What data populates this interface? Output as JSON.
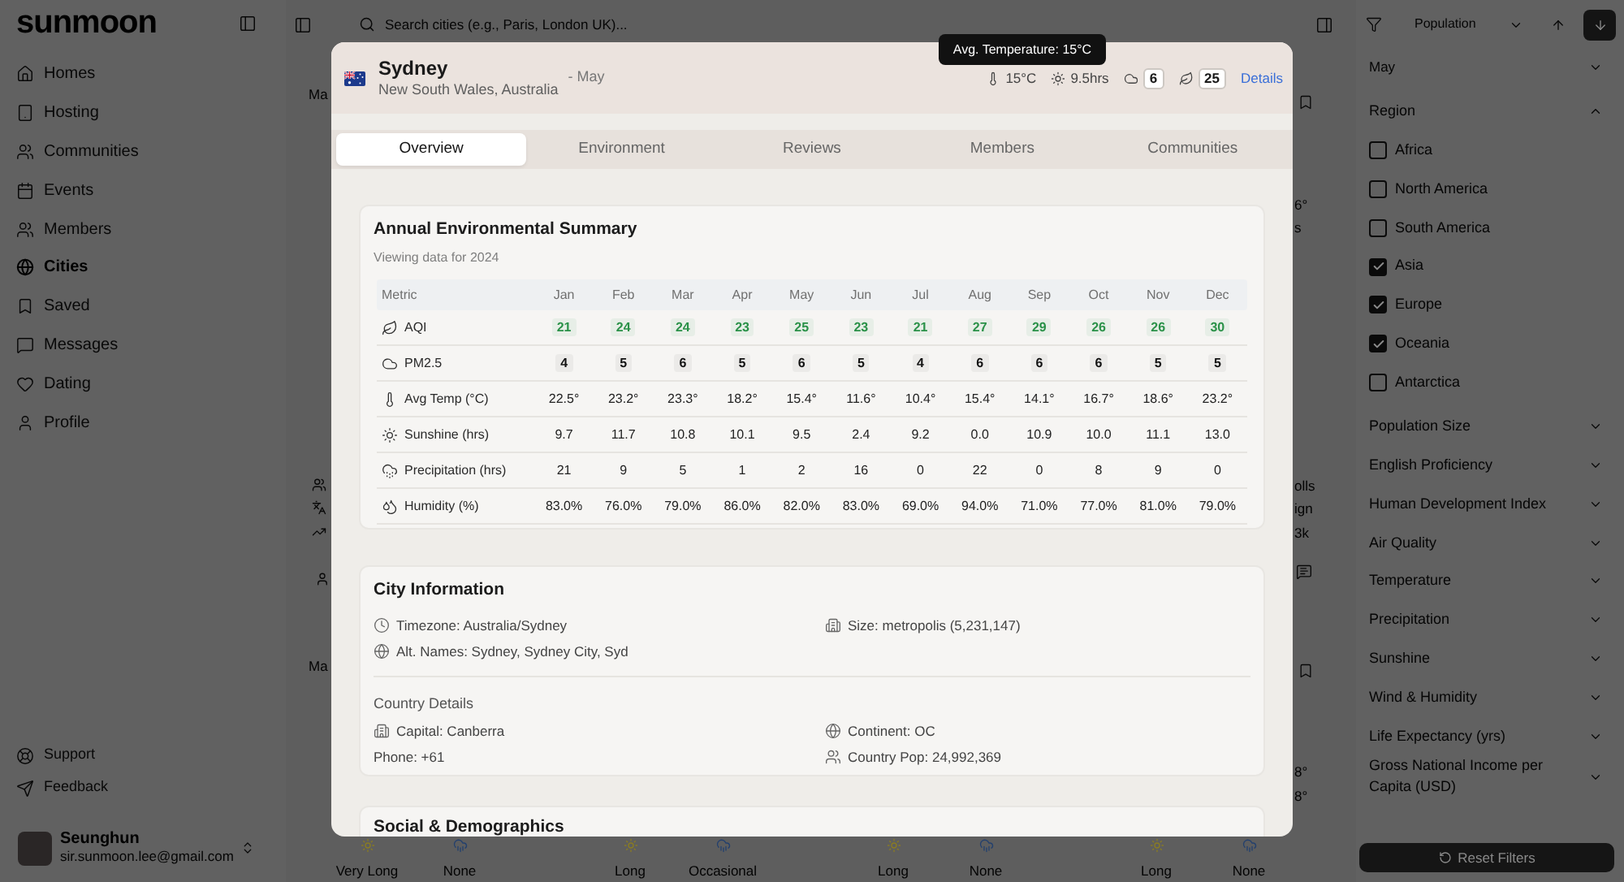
{
  "app": {
    "logo": "sunmoon"
  },
  "sidebar": {
    "items": [
      {
        "label": "Homes",
        "selected": false
      },
      {
        "label": "Hosting",
        "selected": false
      },
      {
        "label": "Communities",
        "selected": false
      },
      {
        "label": "Events",
        "selected": false
      },
      {
        "label": "Members",
        "selected": false
      },
      {
        "label": "Cities",
        "selected": true
      },
      {
        "label": "Saved",
        "selected": false
      },
      {
        "label": "Messages",
        "selected": false
      },
      {
        "label": "Dating",
        "selected": false
      },
      {
        "label": "Profile",
        "selected": false
      }
    ],
    "footer_items": [
      {
        "label": "Support"
      },
      {
        "label": "Feedback"
      }
    ],
    "user": {
      "name": "Seunghun",
      "email": "sir.sunmoon.lee@gmail.com"
    }
  },
  "topbar": {
    "search": {
      "placeholder": "Search cities (e.g., Paris, London UK)..."
    },
    "sort": {
      "value": "Population"
    },
    "sort_buttons": [
      {
        "kind": "ascending",
        "selected": false
      },
      {
        "kind": "descending",
        "selected": true
      }
    ]
  },
  "background": {
    "left_fragments": [
      "Ma",
      "Ma"
    ],
    "right_fragments": [
      "6°",
      "s",
      "olls",
      "ign",
      "3k",
      "8°",
      "8°"
    ],
    "bottom_items": [
      {
        "kind": "sunshine",
        "label": "Very Long"
      },
      {
        "kind": "rain",
        "label": "None"
      },
      {
        "kind": "sunshine",
        "label": "Long"
      },
      {
        "kind": "rain",
        "label": "Occasional"
      },
      {
        "kind": "sunshine",
        "label": "Long"
      },
      {
        "kind": "rain",
        "label": "None"
      },
      {
        "kind": "sunshine",
        "label": "Long"
      },
      {
        "kind": "rain",
        "label": "None"
      }
    ]
  },
  "filters": {
    "month": "May",
    "sections": [
      {
        "title": "Region",
        "expanded": true,
        "options": [
          {
            "label": "Africa",
            "checked": false
          },
          {
            "label": "North America",
            "checked": false
          },
          {
            "label": "South America",
            "checked": false
          },
          {
            "label": "Asia",
            "checked": true
          },
          {
            "label": "Europe",
            "checked": true
          },
          {
            "label": "Oceania",
            "checked": true
          },
          {
            "label": "Antarctica",
            "checked": false
          }
        ]
      },
      {
        "title": "Population Size",
        "expanded": false
      },
      {
        "title": "English Proficiency",
        "expanded": false
      },
      {
        "title": "Human Development Index",
        "expanded": false
      },
      {
        "title": "Air Quality",
        "expanded": false
      },
      {
        "title": "Temperature",
        "expanded": false
      },
      {
        "title": "Precipitation",
        "expanded": false
      },
      {
        "title": "Sunshine",
        "expanded": false
      },
      {
        "title": "Wind & Humidity",
        "expanded": false
      },
      {
        "title": "Life Expectancy (yrs)",
        "expanded": false
      },
      {
        "title": "Gross National Income per Capita (USD)",
        "expanded": false
      }
    ],
    "reset_label": "Reset Filters"
  },
  "city_modal": {
    "header": {
      "city": "Sydney",
      "region": "New South Wales, Australia",
      "month": "- May",
      "stats": [
        {
          "kind": "temperature",
          "value": "15°C"
        },
        {
          "kind": "sunshine",
          "value": "9.5hrs"
        },
        {
          "kind": "pm25",
          "value": "6"
        },
        {
          "kind": "aqi",
          "value": "25"
        }
      ],
      "details_link": "Details"
    },
    "tooltip": "Avg. Temperature: 15°C",
    "tabs": [
      {
        "label": "Overview",
        "selected": true
      },
      {
        "label": "Environment",
        "selected": false
      },
      {
        "label": "Reviews",
        "selected": false
      },
      {
        "label": "Members",
        "selected": false
      },
      {
        "label": "Communities",
        "selected": false
      }
    ],
    "environment_summary": {
      "title": "Annual Environmental Summary",
      "subtitle": "Viewing data for 2024",
      "columns": [
        "Metric",
        "Jan",
        "Feb",
        "Mar",
        "Apr",
        "May",
        "Jun",
        "Jul",
        "Aug",
        "Sep",
        "Oct",
        "Nov",
        "Dec"
      ],
      "rows": [
        {
          "kind": "aqi",
          "label": "AQI",
          "values": [
            "21",
            "24",
            "24",
            "23",
            "25",
            "23",
            "21",
            "27",
            "29",
            "26",
            "26",
            "30"
          ]
        },
        {
          "kind": "pm25",
          "label": "PM2.5",
          "values": [
            "4",
            "5",
            "6",
            "5",
            "6",
            "5",
            "4",
            "6",
            "6",
            "6",
            "5",
            "5"
          ]
        },
        {
          "kind": "temperature",
          "label": "Avg Temp (°C)",
          "values": [
            "22.5°",
            "23.2°",
            "23.3°",
            "18.2°",
            "15.4°",
            "11.6°",
            "10.4°",
            "15.4°",
            "14.1°",
            "16.7°",
            "18.6°",
            "23.2°"
          ]
        },
        {
          "kind": "sunshine",
          "label": "Sunshine (hrs)",
          "values": [
            "9.7",
            "11.7",
            "10.8",
            "10.1",
            "9.5",
            "2.4",
            "9.2",
            "0.0",
            "10.9",
            "10.0",
            "11.1",
            "13.0"
          ]
        },
        {
          "kind": "precipitation",
          "label": "Precipitation (hrs)",
          "values": [
            "21",
            "9",
            "5",
            "1",
            "2",
            "16",
            "0",
            "22",
            "0",
            "8",
            "9",
            "0"
          ]
        },
        {
          "kind": "humidity",
          "label": "Humidity (%)",
          "values": [
            "83.0%",
            "76.0%",
            "79.0%",
            "86.0%",
            "82.0%",
            "83.0%",
            "69.0%",
            "94.0%",
            "71.0%",
            "77.0%",
            "81.0%",
            "79.0%"
          ]
        }
      ]
    },
    "city_information": {
      "title": "City Information",
      "items": [
        {
          "kind": "timezone",
          "text": "Timezone: Australia/Sydney"
        },
        {
          "kind": "size",
          "text": "Size: metropolis (5,231,147)"
        },
        {
          "kind": "names",
          "text": "Alt. Names: Sydney, Sydney City, Syd"
        }
      ],
      "country_title": "Country Details",
      "country_items": [
        {
          "kind": "capital",
          "text": "Capital: Canberra"
        },
        {
          "kind": "continent",
          "text": "Continent: OC"
        },
        {
          "kind": "phone",
          "text": "Phone: +61"
        },
        {
          "kind": "population",
          "text": "Country Pop: 24,992,369"
        }
      ]
    },
    "next_section": {
      "title": "Social & Demographics"
    }
  }
}
